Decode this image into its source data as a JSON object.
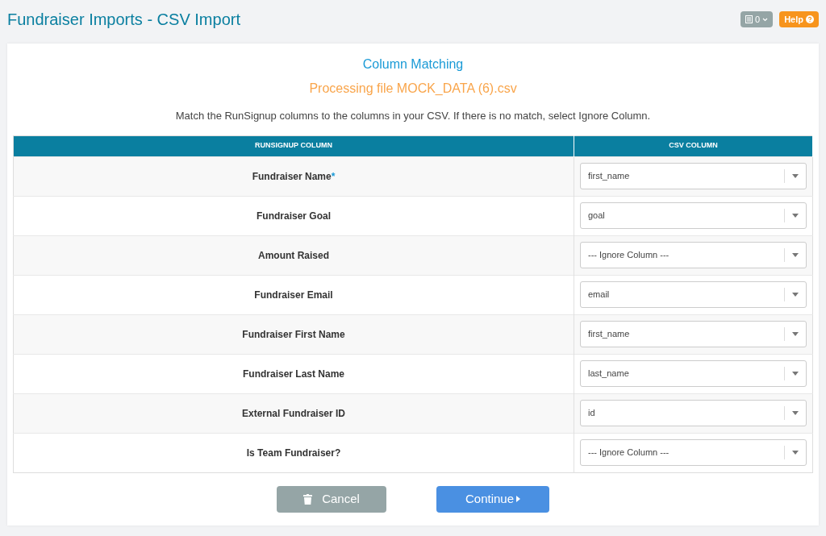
{
  "page_title": "Fundraiser Imports - CSV Import",
  "header_buttons": {
    "notes_count": "0",
    "help": "Help"
  },
  "card": {
    "title": "Column Matching",
    "subtitle": "Processing file MOCK_DATA (6).csv",
    "instructions": "Match the RunSignup columns to the columns in your CSV. If there is no match, select Ignore Column."
  },
  "table": {
    "columns": [
      "RUNSIGNUP COLUMN",
      "CSV COLUMN"
    ],
    "rows": [
      {
        "field": "Fundraiser Name",
        "required_mark": "*",
        "csv_column": "first_name"
      },
      {
        "field": "Fundraiser Goal",
        "csv_column": "goal"
      },
      {
        "field": "Amount Raised",
        "csv_column": "--- Ignore Column ---"
      },
      {
        "field": "Fundraiser Email",
        "csv_column": "email"
      },
      {
        "field": "Fundraiser First Name",
        "csv_column": "first_name"
      },
      {
        "field": "Fundraiser Last Name",
        "csv_column": "last_name"
      },
      {
        "field": "External Fundraiser ID",
        "csv_column": "id"
      },
      {
        "field": "Is Team Fundraiser?",
        "csv_column": "--- Ignore Column ---"
      }
    ]
  },
  "buttons": {
    "cancel": "Cancel",
    "continue": "Continue"
  }
}
